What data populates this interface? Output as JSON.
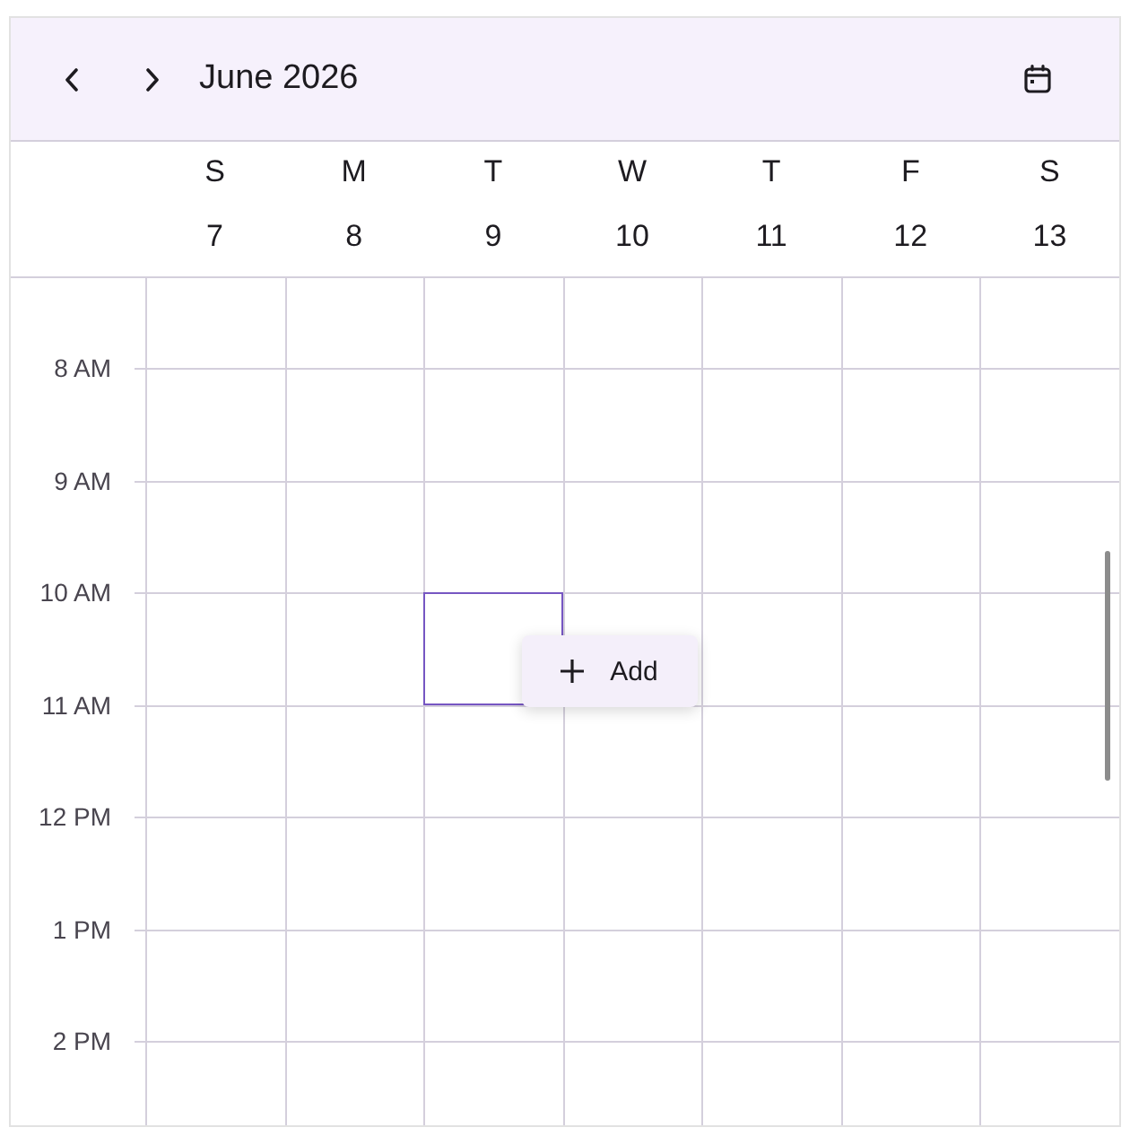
{
  "header": {
    "title": "June 2026"
  },
  "days": [
    {
      "weekday": "S",
      "date": "7"
    },
    {
      "weekday": "M",
      "date": "8"
    },
    {
      "weekday": "T",
      "date": "9"
    },
    {
      "weekday": "W",
      "date": "10"
    },
    {
      "weekday": "T",
      "date": "11"
    },
    {
      "weekday": "F",
      "date": "12"
    },
    {
      "weekday": "S",
      "date": "13"
    }
  ],
  "rows": [
    {
      "slots": [
        {
          "selected": false
        },
        {
          "selected": false
        },
        {
          "selected": false
        },
        {
          "selected": false
        },
        {
          "selected": false
        },
        {
          "selected": false
        },
        {
          "selected": false
        }
      ]
    },
    {
      "label": "8 AM",
      "slots": [
        {
          "selected": false
        },
        {
          "selected": false
        },
        {
          "selected": false
        },
        {
          "selected": false
        },
        {
          "selected": false
        },
        {
          "selected": false
        },
        {
          "selected": false
        }
      ]
    },
    {
      "label": "9 AM",
      "slots": [
        {
          "selected": false
        },
        {
          "selected": false
        },
        {
          "selected": false
        },
        {
          "selected": false
        },
        {
          "selected": false
        },
        {
          "selected": false
        },
        {
          "selected": false
        }
      ]
    },
    {
      "label": "10 AM",
      "slots": [
        {
          "selected": false
        },
        {
          "selected": false
        },
        {
          "selected": true
        },
        {
          "selected": false
        },
        {
          "selected": false
        },
        {
          "selected": false
        },
        {
          "selected": false
        }
      ]
    },
    {
      "label": "11 AM",
      "slots": [
        {
          "selected": false
        },
        {
          "selected": false
        },
        {
          "selected": false
        },
        {
          "selected": false
        },
        {
          "selected": false
        },
        {
          "selected": false
        },
        {
          "selected": false
        }
      ]
    },
    {
      "label": "12 PM",
      "slots": [
        {
          "selected": false
        },
        {
          "selected": false
        },
        {
          "selected": false
        },
        {
          "selected": false
        },
        {
          "selected": false
        },
        {
          "selected": false
        },
        {
          "selected": false
        }
      ]
    },
    {
      "label": "1 PM",
      "slots": [
        {
          "selected": false
        },
        {
          "selected": false
        },
        {
          "selected": false
        },
        {
          "selected": false
        },
        {
          "selected": false
        },
        {
          "selected": false
        },
        {
          "selected": false
        }
      ]
    },
    {
      "label": "2 PM",
      "slots": [
        {
          "selected": false
        },
        {
          "selected": false
        },
        {
          "selected": false
        },
        {
          "selected": false
        },
        {
          "selected": false
        },
        {
          "selected": false
        },
        {
          "selected": false
        }
      ]
    }
  ],
  "add_popup": {
    "label": "Add"
  }
}
